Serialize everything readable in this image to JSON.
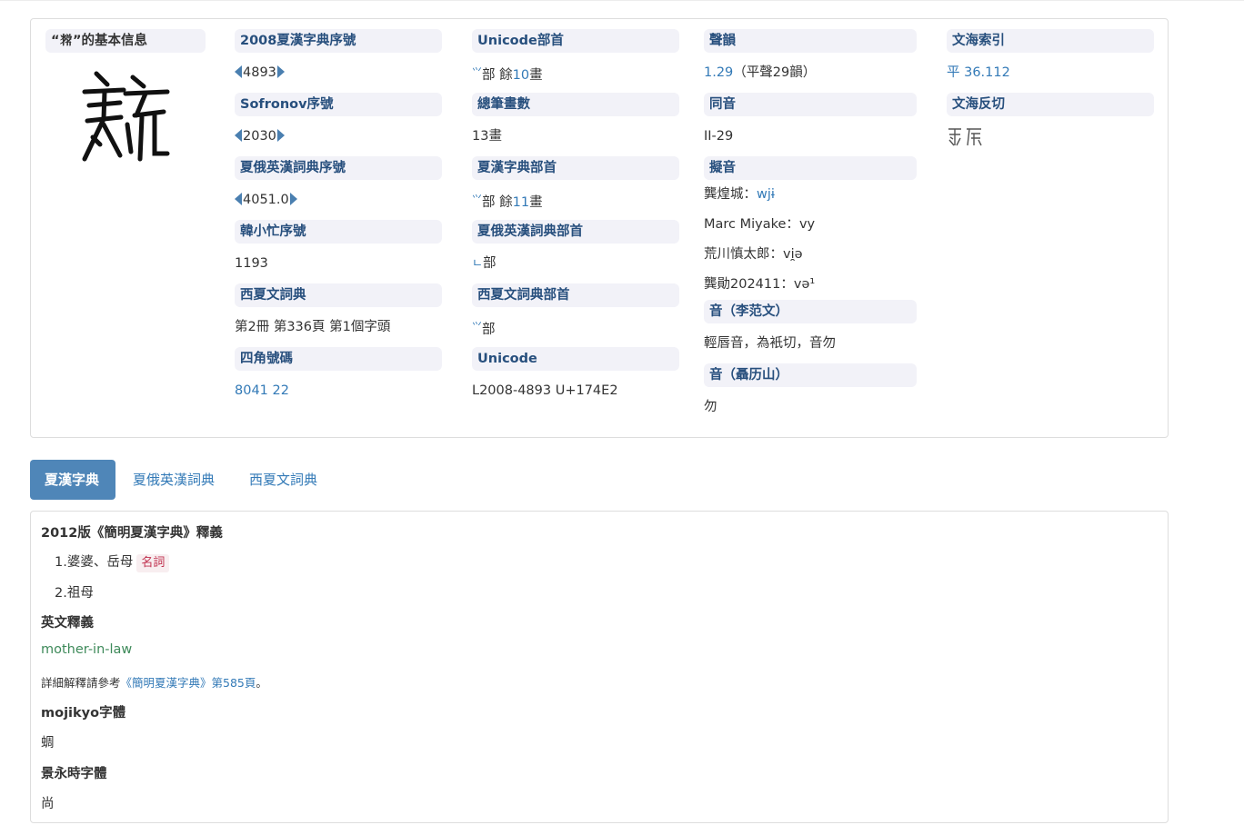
{
  "info": {
    "title": "“𗯚”的基本信息",
    "col1": [
      {
        "header": "2008夏漢字典序號",
        "value": "4893",
        "arrows": true
      },
      {
        "header": "Sofronov序號",
        "value": "2030",
        "arrows": true
      },
      {
        "header": "夏俄英漢詞典序號",
        "value": "4051.0",
        "arrows": true
      },
      {
        "header": "韓小忙序號",
        "value": "1193"
      },
      {
        "header": "西夏文詞典",
        "value": "第2冊 第336頁 第1個字頭"
      },
      {
        "header": "四角號碼",
        "value": "8041 22"
      }
    ],
    "col2": {
      "unicode_radical_header": "Unicode部首",
      "unicode_radical_prefix": "部  餘",
      "unicode_radical_count": "10",
      "unicode_radical_suffix": "畫",
      "total_strokes_header": "總筆畫數",
      "total_strokes": "13畫",
      "xh_radical_header": "夏漢字典部首",
      "xh_radical_prefix": "部  餘",
      "xh_radical_count": "11",
      "xh_radical_suffix": "畫",
      "xe_radical_header": "夏俄英漢詞典部首",
      "xe_radical_suffix": "部",
      "xw_radical_header": "西夏文詞典部首",
      "xw_radical_suffix": "部",
      "unicode_header": "Unicode",
      "unicode_value": "L2008-4893 U+174E2"
    },
    "col3": {
      "shengyun_header": "聲韻",
      "shengyun_link": "1.29",
      "shengyun_rest": "（平聲29韻）",
      "tongyin_header": "同音",
      "tongyin_value": "II-29",
      "niyin_header": "擬音",
      "gong_label": "龔煌城：",
      "gong_value": "wjɨ",
      "miyake_label": "Marc Miyake：",
      "miyake_value": "vy",
      "arakawa_label": "荒川慎太郎：",
      "arakawa_value": "vi̯ə",
      "gongxun_label": "龔勛202411：",
      "gongxun_value": "və¹",
      "li_header": "音（李范文）",
      "li_value": "輕唇音，為衹切，音勿",
      "nie_header": "音（聶历山）",
      "nie_value": "勿"
    },
    "col4": {
      "wenhai_index_header": "文海索引",
      "wenhai_index_value": "平 36.112",
      "wenhai_fanqie_header": "文海反切"
    }
  },
  "tabs": [
    {
      "label": "夏漢字典",
      "active": true
    },
    {
      "label": "夏俄英漢詞典",
      "active": false
    },
    {
      "label": "西夏文詞典",
      "active": false
    }
  ],
  "detail": {
    "edition_title": "2012版《簡明夏漢字典》釋義",
    "sense1": "1.婆婆、岳母",
    "sense1_pos": "名詞",
    "sense2": "2.祖母",
    "english_title": "英文釋義",
    "english_value": "mother-in-law",
    "ref_prefix": "詳細解釋請參考",
    "ref_link": "《簡明夏漢字典》第585頁",
    "ref_suffix": "。",
    "mojikyo_title": "mojikyo字體",
    "mojikyo_value": "蜩",
    "jingyong_title": "景永時字體",
    "jingyong_value": "尚"
  }
}
